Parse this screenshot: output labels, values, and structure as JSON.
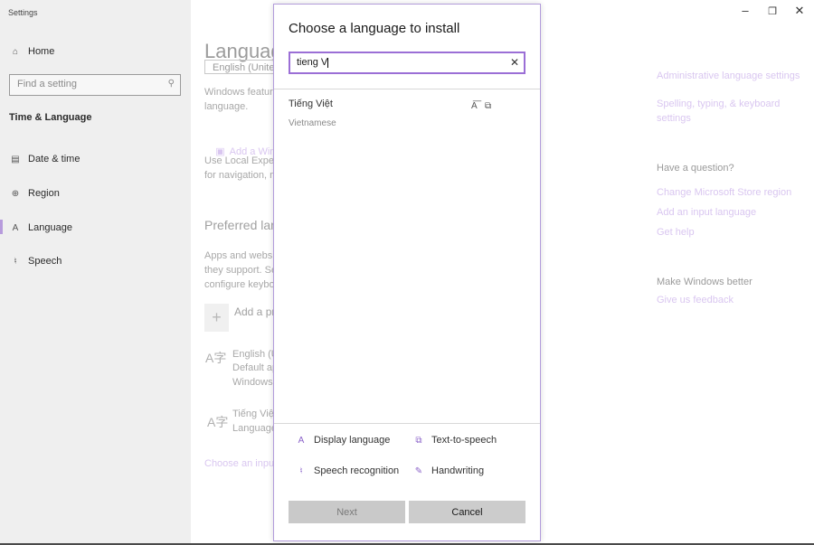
{
  "app_title": "Settings",
  "sidebar": {
    "home": "Home",
    "search_placeholder": "Find a setting",
    "section": "Time & Language",
    "items": [
      {
        "label": "Date & time",
        "icon": "calendar-clock-icon"
      },
      {
        "label": "Region",
        "icon": "globe-icon"
      },
      {
        "label": "Language",
        "icon": "language-icon",
        "active": true
      },
      {
        "label": "Speech",
        "icon": "microphone-icon"
      }
    ]
  },
  "main": {
    "title": "Language",
    "display_lang_select": "English (United",
    "windows_features_1": "Windows features",
    "windows_features_2": "language.",
    "add_windows_link": "Add a Windo",
    "local_exp_1": "Use Local Experie",
    "local_exp_2": "for navigation, me",
    "preferred_heading": "Preferred lang",
    "apps_text_1": "Apps and website",
    "apps_text_2": "they support. Sele",
    "apps_text_3": "configure keyboa",
    "add_preferred": "Add a pre",
    "lang1_name": "English (Ur",
    "lang1_sub1": "Default ap",
    "lang1_sub2": "Windows c",
    "lang2_name": "Tiếng Việt",
    "lang2_sub": "Language",
    "choose_input_link": "Choose an input"
  },
  "right_panel": {
    "admin_link": "Administrative language settings",
    "spelling_link_1": "Spelling, typing, & keyboard",
    "spelling_link_2": "settings",
    "question_heading": "Have a question?",
    "store_region_link": "Change Microsoft Store region",
    "add_input_link": "Add an input language",
    "help_link": "Get help",
    "better_heading": "Make Windows better",
    "feedback_link": "Give us feedback"
  },
  "window_controls": {
    "minimize": "–",
    "restore": "❐",
    "close": "✕"
  },
  "dialog": {
    "title": "Choose a language to install",
    "search_value": "tieng V",
    "clear_icon": "✕",
    "result": {
      "name": "Tiếng Việt",
      "subtitle": "Vietnamese"
    },
    "features": [
      {
        "label": "Display language",
        "icon": "display-language-icon"
      },
      {
        "label": "Text-to-speech",
        "icon": "text-to-speech-icon"
      },
      {
        "label": "Speech recognition",
        "icon": "speech-recognition-icon"
      },
      {
        "label": "Handwriting",
        "icon": "handwriting-icon"
      }
    ],
    "next_label": "Next",
    "cancel_label": "Cancel"
  },
  "colors": {
    "accent": "#9b6fd6",
    "link_faded": "#d9c6f0"
  }
}
